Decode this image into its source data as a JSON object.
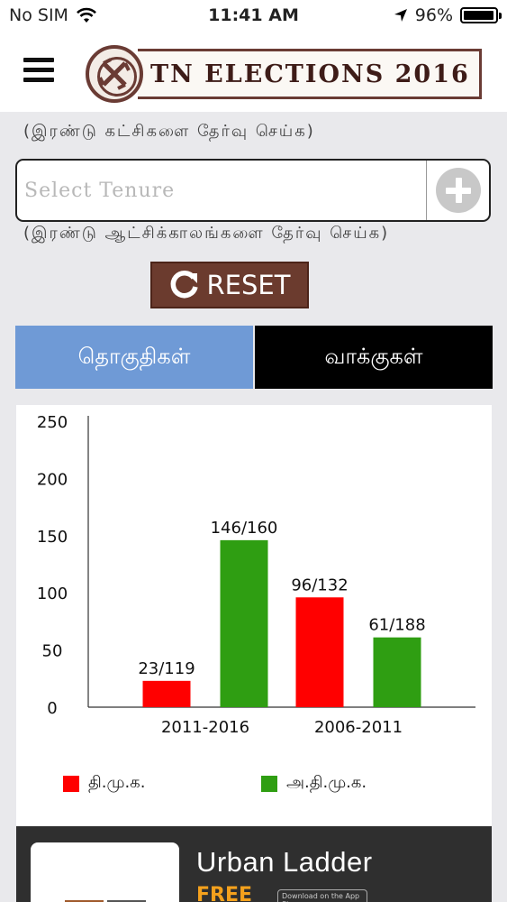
{
  "status_bar": {
    "carrier": "No SIM",
    "time": "11:41 AM",
    "battery": "96%",
    "battery_level": 0.96
  },
  "header": {
    "title": "TN ELECTIONS 2016"
  },
  "form": {
    "parties_hint": "(இரண்டு கட்சிகளை தேர்வு செய்க)",
    "tenure_placeholder": "Select Tenure",
    "tenure_hint": "(இரண்டு ஆட்சிக்காலங்களை தேர்வு செய்க)",
    "reset_label": "RESET"
  },
  "tabs": [
    {
      "label": "தொகுதிகள்",
      "active": true
    },
    {
      "label": "வாக்குகள்",
      "active": false
    }
  ],
  "chart_data": {
    "type": "bar",
    "categories": [
      "2011-2016",
      "2006-2011"
    ],
    "series": [
      {
        "name": "தி.மு.க.",
        "color": "#ff0000",
        "values": [
          23,
          96
        ],
        "labels": [
          "23/119",
          "96/132"
        ]
      },
      {
        "name": "அ.தி.மு.க.",
        "color": "#2f9e12",
        "values": [
          146,
          61
        ],
        "labels": [
          "146/160",
          "61/188"
        ]
      }
    ],
    "ylim": [
      0,
      250
    ],
    "yticks": [
      "0",
      "50",
      "100",
      "150",
      "200",
      "250"
    ],
    "grid": false,
    "legend_position": "bottom"
  },
  "ad": {
    "title": "Urban Ladder",
    "free": "FREE",
    "download": "Download on the App Store"
  }
}
